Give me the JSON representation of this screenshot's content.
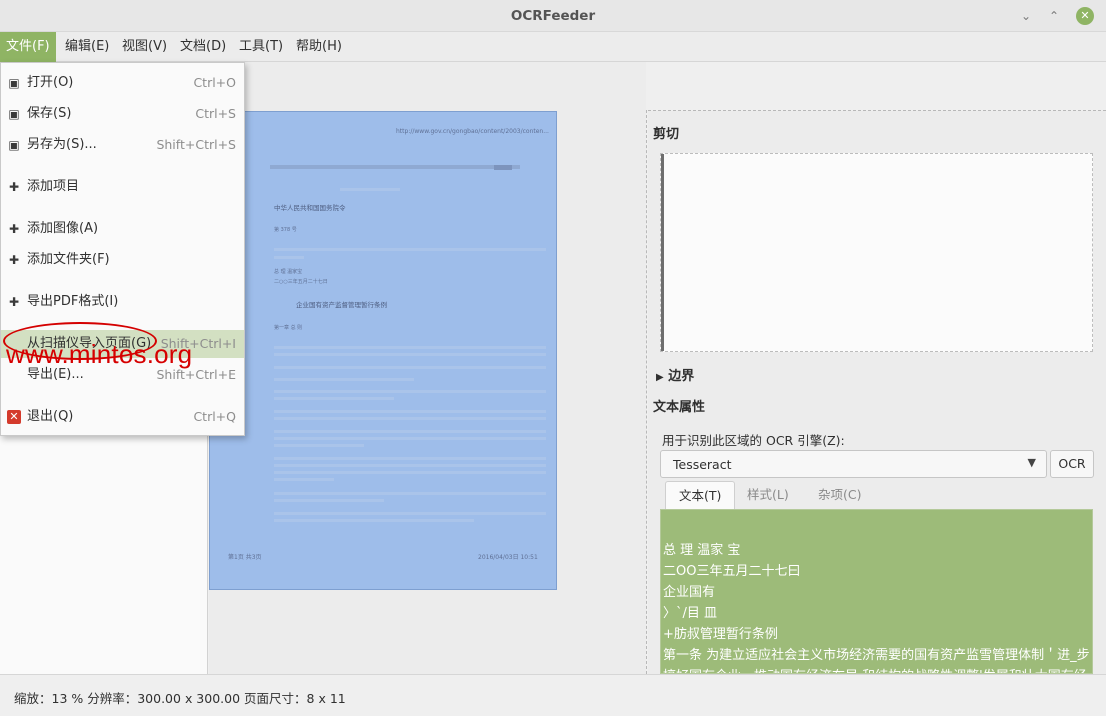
{
  "window": {
    "title": "OCRFeeder"
  },
  "menubar": [
    {
      "label": "文件(F)"
    },
    {
      "label": "编辑(E)"
    },
    {
      "label": "视图(V)"
    },
    {
      "label": "文档(D)"
    },
    {
      "label": "工具(T)"
    },
    {
      "label": "帮助(H)"
    }
  ],
  "file_menu": {
    "items": [
      {
        "icon": "open-icon",
        "glyph": "▣",
        "label": "打开(O)",
        "accel": "Ctrl+O"
      },
      {
        "icon": "save-icon",
        "glyph": "▣",
        "label": "保存(S)",
        "accel": "Ctrl+S"
      },
      {
        "icon": "save-as-icon",
        "glyph": "▣",
        "label": "另存为(S)...",
        "accel": "Shift+Ctrl+S"
      },
      {
        "icon": "plus-icon",
        "glyph": "✚",
        "label": "添加项目",
        "accel": ""
      },
      {
        "icon": "plus-icon",
        "glyph": "✚",
        "label": "添加图像(A)",
        "accel": ""
      },
      {
        "icon": "plus-icon",
        "glyph": "✚",
        "label": "添加文件夹(F)",
        "accel": ""
      },
      {
        "icon": "plus-icon",
        "glyph": "✚",
        "label": "导出PDF格式(I)",
        "accel": ""
      },
      {
        "icon": "",
        "glyph": "",
        "label": "从扫描仪导入页面(G)",
        "accel": "Shift+Ctrl+I"
      },
      {
        "icon": "",
        "glyph": "",
        "label": "导出(E)...",
        "accel": "Shift+Ctrl+E"
      },
      {
        "icon": "quit-icon",
        "glyph": "✕",
        "label": "退出(Q)",
        "accel": "Ctrl+Q"
      }
    ]
  },
  "watermark": "www.mintos.org",
  "page_preview": {
    "url": "http://www.gov.cn/gongbao/content/2003/conten...",
    "heading": "中华人民共和国国务院令",
    "number": "第 378 号",
    "sign": "总 理 温家宝",
    "date": "二○○三年五月二十七日",
    "title": "企业国有资产监督管理暂行条例",
    "chapter": "第一章 总 则",
    "footer_left": "第1页 共3页",
    "footer_right": "2016/04/03日 10:51"
  },
  "right_panel": {
    "crop_title": "剪切",
    "bounds_title": "边界",
    "text_props_title": "文本属性",
    "engine_label": "用于识别此区域的 OCR 引擎(Z):",
    "engine_value": "Tesseract",
    "ocr_button": "OCR",
    "tabs": [
      {
        "label": "文本(T)"
      },
      {
        "label": "样式(L)"
      },
      {
        "label": "杂项(C)"
      }
    ],
    "ocr_text": [
      "总 理 温家 宝",
      "二OO三年五月二十七曰",
      "企业国有",
      "〉`/目 皿",
      "+肪叔管理暂行条例",
      "第一条 为建立适应社会主义市场经济需要的国有资产监雪管理体制＇进_步",
      "搞好国有企业，推动国有经济布局 和结构的战略性调整'发展和壮大国有经"
    ]
  },
  "statusbar": {
    "text": "缩放：13 % 分辨率：300.00 x 300.00 页面尺寸：8 x 11"
  }
}
